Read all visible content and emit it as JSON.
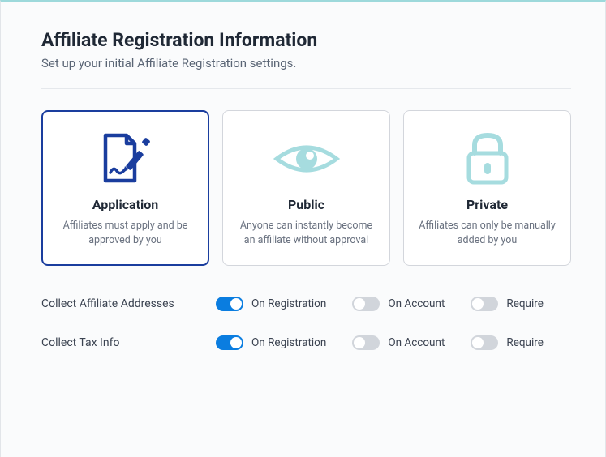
{
  "header": {
    "title": "Affiliate Registration Information",
    "subtitle": "Set up your initial Affiliate Registration settings."
  },
  "modes": {
    "application": {
      "title": "Application",
      "desc": "Affiliates must apply and be approved by you"
    },
    "public": {
      "title": "Public",
      "desc": "Anyone can instantly become an affiliate without approval"
    },
    "private": {
      "title": "Private",
      "desc": "Affiliates can only be manually added by you"
    }
  },
  "settings": {
    "addresses": {
      "label": "Collect Affiliate Addresses",
      "opts": {
        "reg": "On Registration",
        "acct": "On Account",
        "req": "Require"
      }
    },
    "tax": {
      "label": "Collect Tax Info",
      "opts": {
        "reg": "On Registration",
        "acct": "On Account",
        "req": "Require"
      }
    }
  }
}
